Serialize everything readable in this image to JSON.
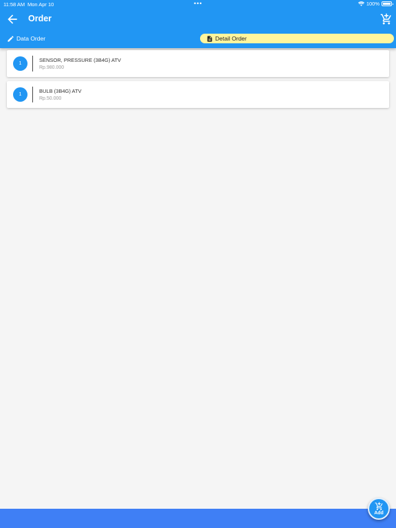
{
  "status_bar": {
    "time": "11:58 AM",
    "date": "Mon Apr 10",
    "battery": "100%"
  },
  "header": {
    "title": "Order"
  },
  "tabs": {
    "data_order": "Data Order",
    "detail_order": "Detail Order"
  },
  "items": [
    {
      "qty": "1",
      "name": "SENSOR, PRESSURE (3B4G) ATV",
      "price": "Rp.980.000"
    },
    {
      "qty": "1",
      "name": "BULB (3B4G) ATV",
      "price": "Rp.50.000"
    }
  ],
  "fab": {
    "label": "Add"
  },
  "colors": {
    "primary": "#2196f3",
    "tab_highlight": "#fff59d",
    "bottom_bar": "#3f7ff5",
    "background": "#f5f5f5"
  },
  "icons": {
    "back": "arrow-back-icon",
    "cart": "cart-add-icon",
    "data_tab": "pencil-icon",
    "detail_tab": "document-icon",
    "fab": "cart-add-icon"
  }
}
